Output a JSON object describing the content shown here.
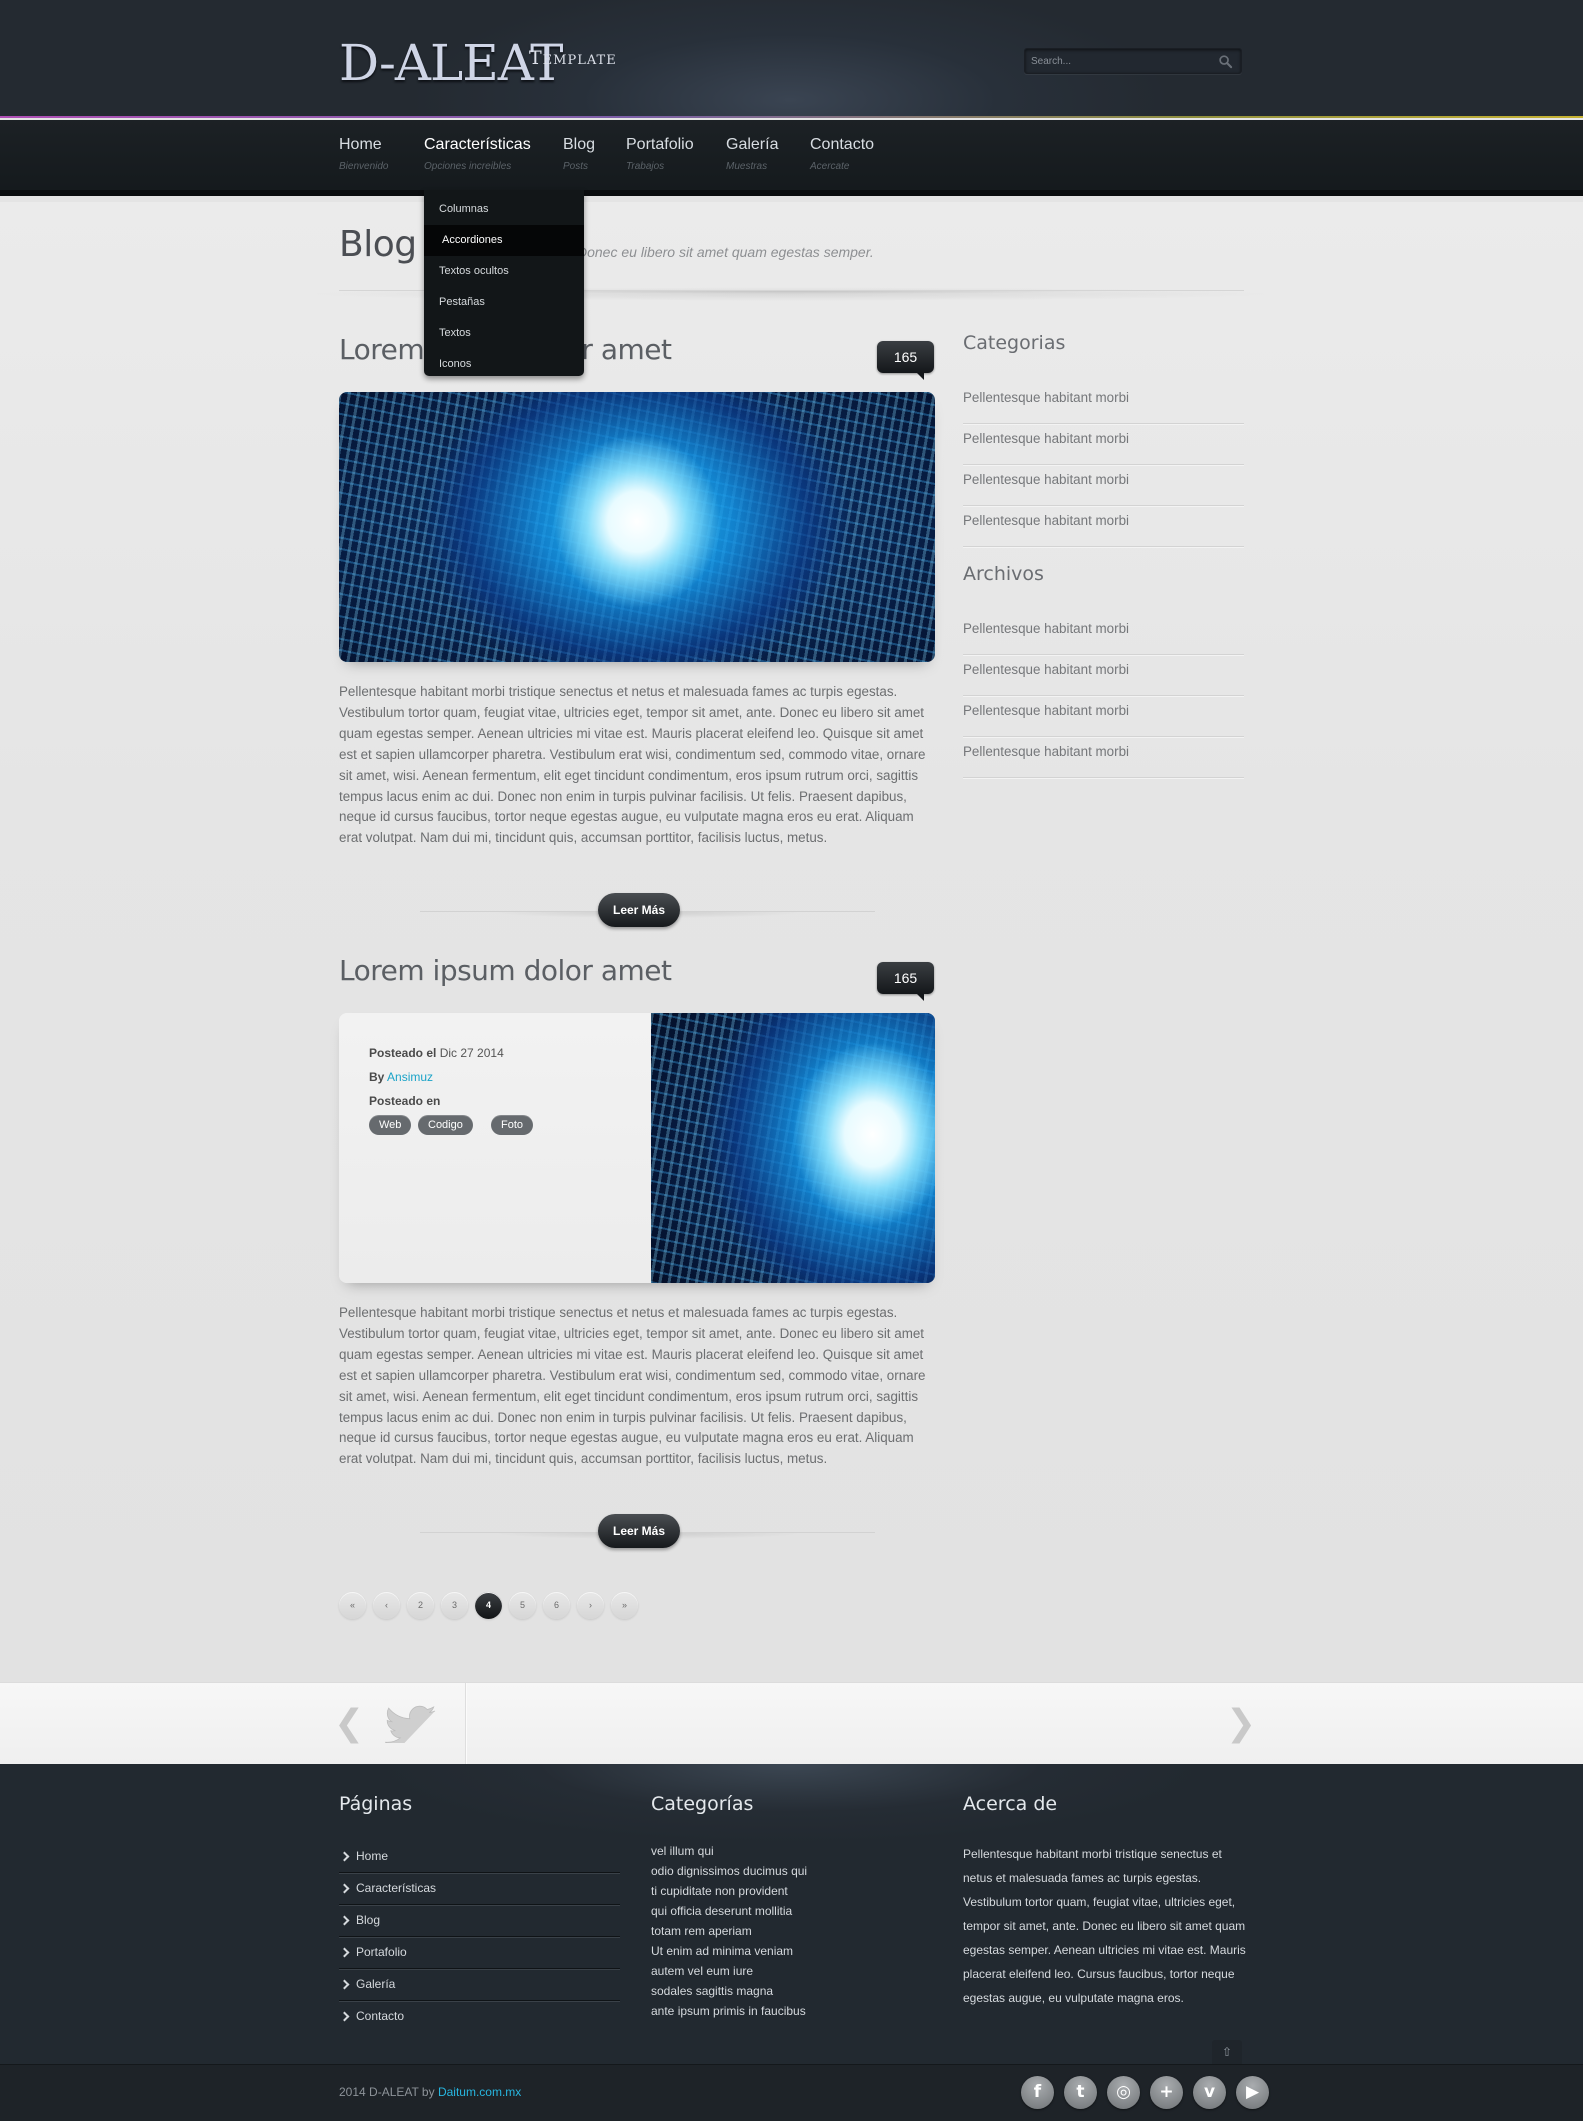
{
  "header": {
    "logo": "D-ALEAT",
    "logo_sub": "Template",
    "search_placeholder": "Search..."
  },
  "nav": [
    {
      "label": "Home",
      "sub": "Bienvenido"
    },
    {
      "label": "Características",
      "sub": "Opciones increibles"
    },
    {
      "label": "Blog",
      "sub": "Posts"
    },
    {
      "label": "Portafolio",
      "sub": "Trabajos"
    },
    {
      "label": "Galería",
      "sub": "Muestras"
    },
    {
      "label": "Contacto",
      "sub": "Acercate"
    }
  ],
  "dropdown": [
    "Columnas",
    "Accordiones",
    "Textos ocultos",
    "Pestañas",
    "Textos",
    "Iconos"
  ],
  "page": {
    "title": "Blog",
    "tagline": "Donec eu libero sit amet quam egestas semper."
  },
  "posts": [
    {
      "title": "Lorem ipsum dolor amet",
      "comments": "165",
      "text": "Pellentesque habitant morbi tristique senectus et netus et malesuada fames ac turpis egestas. Vestibulum tortor quam, feugiat vitae, ultricies eget, tempor sit amet, ante. Donec eu libero sit amet quam egestas semper. Aenean ultricies mi vitae est. Mauris placerat eleifend leo. Quisque sit amet est et sapien ullamcorper pharetra. Vestibulum erat wisi, condimentum sed, commodo vitae, ornare sit amet, wisi. Aenean fermentum, elit eget tincidunt condimentum, eros ipsum rutrum orci, sagittis tempus lacus enim ac dui. Donec non enim in turpis pulvinar facilisis. Ut felis. Praesent dapibus, neque id cursus faucibus, tortor neque egestas augue, eu vulputate magna eros eu erat. Aliquam erat volutpat. Nam dui mi, tincidunt quis, accumsan porttitor, facilisis luctus, metus.",
      "read_more": "Leer Más"
    },
    {
      "title": "Lorem ipsum dolor amet",
      "comments": "165",
      "text": "Pellentesque habitant morbi tristique senectus et netus et malesuada fames ac turpis egestas. Vestibulum tortor quam, feugiat vitae, ultricies eget, tempor sit amet, ante. Donec eu libero sit amet quam egestas semper. Aenean ultricies mi vitae est. Mauris placerat eleifend leo. Quisque sit amet est et sapien ullamcorper pharetra. Vestibulum erat wisi, condimentum sed, commodo vitae, ornare sit amet, wisi. Aenean fermentum, elit eget tincidunt condimentum, eros ipsum rutrum orci, sagittis tempus lacus enim ac dui. Donec non enim in turpis pulvinar facilisis. Ut felis. Praesent dapibus, neque id cursus faucibus, tortor neque egestas augue, eu vulputate magna eros eu erat. Aliquam erat volutpat. Nam dui mi, tincidunt quis, accumsan porttitor, facilisis luctus, metus.",
      "read_more": "Leer Más",
      "meta": {
        "posted_label": "Posteado el",
        "date": "Dic 27 2014",
        "by_label": "By",
        "author": "Ansimuz",
        "in_label": "Posteado en",
        "tags": [
          "Web",
          "Codigo",
          "Foto"
        ]
      }
    }
  ],
  "pagination": [
    "«",
    "‹",
    "2",
    "3",
    "4",
    "5",
    "6",
    "›",
    "»"
  ],
  "pagination_active": "4",
  "sidebar": {
    "categories_title": "Categorias",
    "categories": [
      "Pellentesque habitant morbi",
      "Pellentesque habitant morbi",
      "Pellentesque habitant morbi",
      "Pellentesque habitant morbi"
    ],
    "archives_title": "Archivos",
    "archives": [
      "Pellentesque habitant morbi",
      "Pellentesque habitant morbi",
      "Pellentesque habitant morbi",
      "Pellentesque habitant morbi"
    ]
  },
  "strip": {
    "prev": "❮",
    "next": "❯"
  },
  "footer": {
    "pages_title": "Páginas",
    "pages": [
      "Home",
      "Características",
      "Blog",
      "Portafolio",
      "Galería",
      "Contacto"
    ],
    "categories_title": "Categorías",
    "categories": [
      "vel illum qui",
      "odio dignissimos ducimus qui",
      "ti cupiditate non provident",
      "qui officia deserunt mollitia",
      "totam rem aperiam",
      "Ut enim ad minima veniam",
      "autem vel eum iure",
      "sodales sagittis magna",
      "ante ipsum primis in faucibus"
    ],
    "about_title": "Acerca de",
    "about_text": "Pellentesque habitant morbi tristique senectus et netus et malesuada fames ac turpis egestas. Vestibulum tortor quam, feugiat vitae, ultricies eget, tempor sit amet, ante. Donec eu libero sit amet quam egestas semper. Aenean ultricies mi vitae est. Mauris placerat eleifend leo. Cursus faucibus, tortor neque egestas augue, eu vulputate magna eros.",
    "to_top": "⇧",
    "copyright_prefix": "2014 D-ALEAT by",
    "copyright_link": "Daitum.com.mx"
  },
  "social": [
    {
      "icon": "facebook-icon",
      "glyph": "f"
    },
    {
      "icon": "twitter-icon",
      "glyph": "t"
    },
    {
      "icon": "dribbble-icon",
      "glyph": "◎"
    },
    {
      "icon": "plus-icon",
      "glyph": "+"
    },
    {
      "icon": "vimeo-icon",
      "glyph": "v"
    },
    {
      "icon": "youtube-icon",
      "glyph": "▶"
    }
  ],
  "colors": {
    "accent": "#1aa3c7",
    "header_bg": "#28303a",
    "nav_bg": "#1c2125",
    "footer_bg": "#252c34"
  }
}
